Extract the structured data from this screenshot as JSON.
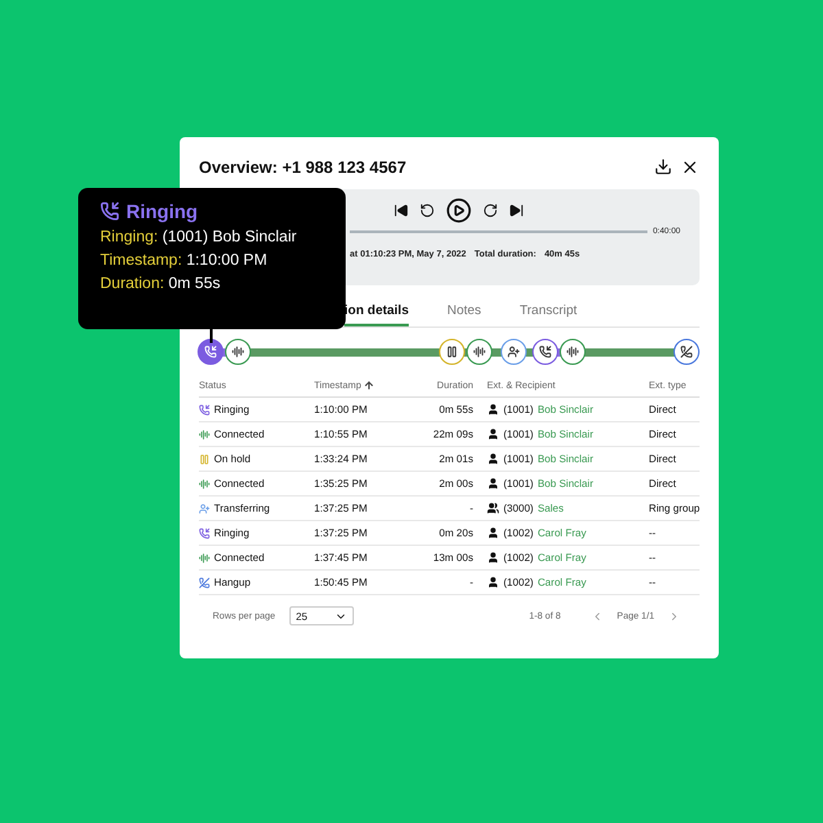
{
  "overview": {
    "title": "Overview: +1 988 123 4567"
  },
  "player": {
    "end_time": "0:40:00",
    "started": "at 01:10:23 PM, May 7, 2022",
    "duration_label": "Total duration:",
    "duration": "40m 45s"
  },
  "tabs": [
    {
      "label": "ion details",
      "selected": true
    },
    {
      "label": "Notes",
      "selected": false
    },
    {
      "label": "Transcript",
      "selected": false
    }
  ],
  "timeline": [
    {
      "kind": "ringing",
      "selected": true
    },
    {
      "kind": "connected",
      "selected": false
    },
    {
      "kind": "hold",
      "selected": false
    },
    {
      "kind": "connected",
      "selected": false
    },
    {
      "kind": "transfer",
      "selected": false
    },
    {
      "kind": "ringing",
      "selected": false
    },
    {
      "kind": "connected",
      "selected": false
    },
    {
      "kind": "hangup",
      "selected": false
    }
  ],
  "table": {
    "columns": [
      {
        "label": "Status",
        "sorted": false
      },
      {
        "label": "Timestamp",
        "sorted": true
      },
      {
        "label": "Duration",
        "sorted": false
      },
      {
        "label": "Ext. & Recipient",
        "sorted": false
      },
      {
        "label": "Ext. type",
        "sorted": false
      }
    ],
    "rows": [
      {
        "kind": "ringing",
        "status": "Ringing",
        "timestamp": "1:10:00 PM",
        "duration": "0m 55s",
        "recipient": {
          "kind": "person",
          "ext": "(1001)",
          "name": "Bob Sinclair"
        },
        "ext_type": "Direct"
      },
      {
        "kind": "connected",
        "status": "Connected",
        "timestamp": "1:10:55 PM",
        "duration": "22m 09s",
        "recipient": {
          "kind": "person",
          "ext": "(1001)",
          "name": "Bob Sinclair"
        },
        "ext_type": "Direct"
      },
      {
        "kind": "hold",
        "status": "On hold",
        "timestamp": "1:33:24 PM",
        "duration": "2m 01s",
        "recipient": {
          "kind": "person",
          "ext": "(1001)",
          "name": "Bob Sinclair"
        },
        "ext_type": "Direct"
      },
      {
        "kind": "connected",
        "status": "Connected",
        "timestamp": "1:35:25 PM",
        "duration": "2m 00s",
        "recipient": {
          "kind": "person",
          "ext": "(1001)",
          "name": "Bob Sinclair"
        },
        "ext_type": "Direct"
      },
      {
        "kind": "transfer",
        "status": "Transferring",
        "timestamp": "1:37:25 PM",
        "duration": "-",
        "recipient": {
          "kind": "group",
          "ext": "(3000)",
          "name": "Sales"
        },
        "ext_type": "Ring group"
      },
      {
        "kind": "ringing",
        "status": "Ringing",
        "timestamp": "1:37:25 PM",
        "duration": "0m 20s",
        "recipient": {
          "kind": "person",
          "ext": "(1002)",
          "name": "Carol Fray"
        },
        "ext_type": "--"
      },
      {
        "kind": "connected",
        "status": "Connected",
        "timestamp": "1:37:45 PM",
        "duration": "13m 00s",
        "recipient": {
          "kind": "person",
          "ext": "(1002)",
          "name": "Carol Fray"
        },
        "ext_type": "--"
      },
      {
        "kind": "hangup",
        "status": "Hangup",
        "timestamp": "1:50:45 PM",
        "duration": "-",
        "recipient": {
          "kind": "person",
          "ext": "(1002)",
          "name": "Carol Fray"
        },
        "ext_type": "--"
      }
    ]
  },
  "pagination": {
    "rows_per_page_label": "Rows per page",
    "rows_per_page": "25",
    "range": "1-8 of 8",
    "page": "Page 1/1"
  },
  "tooltip": {
    "kind": "ringing",
    "title": "Ringing",
    "lines": [
      {
        "label": "Ringing:",
        "value": "(1001) Bob Sinclair"
      },
      {
        "label": "Timestamp:",
        "value": "1:10:00 PM"
      },
      {
        "label": "Duration:",
        "value": "0m 55s"
      }
    ]
  }
}
